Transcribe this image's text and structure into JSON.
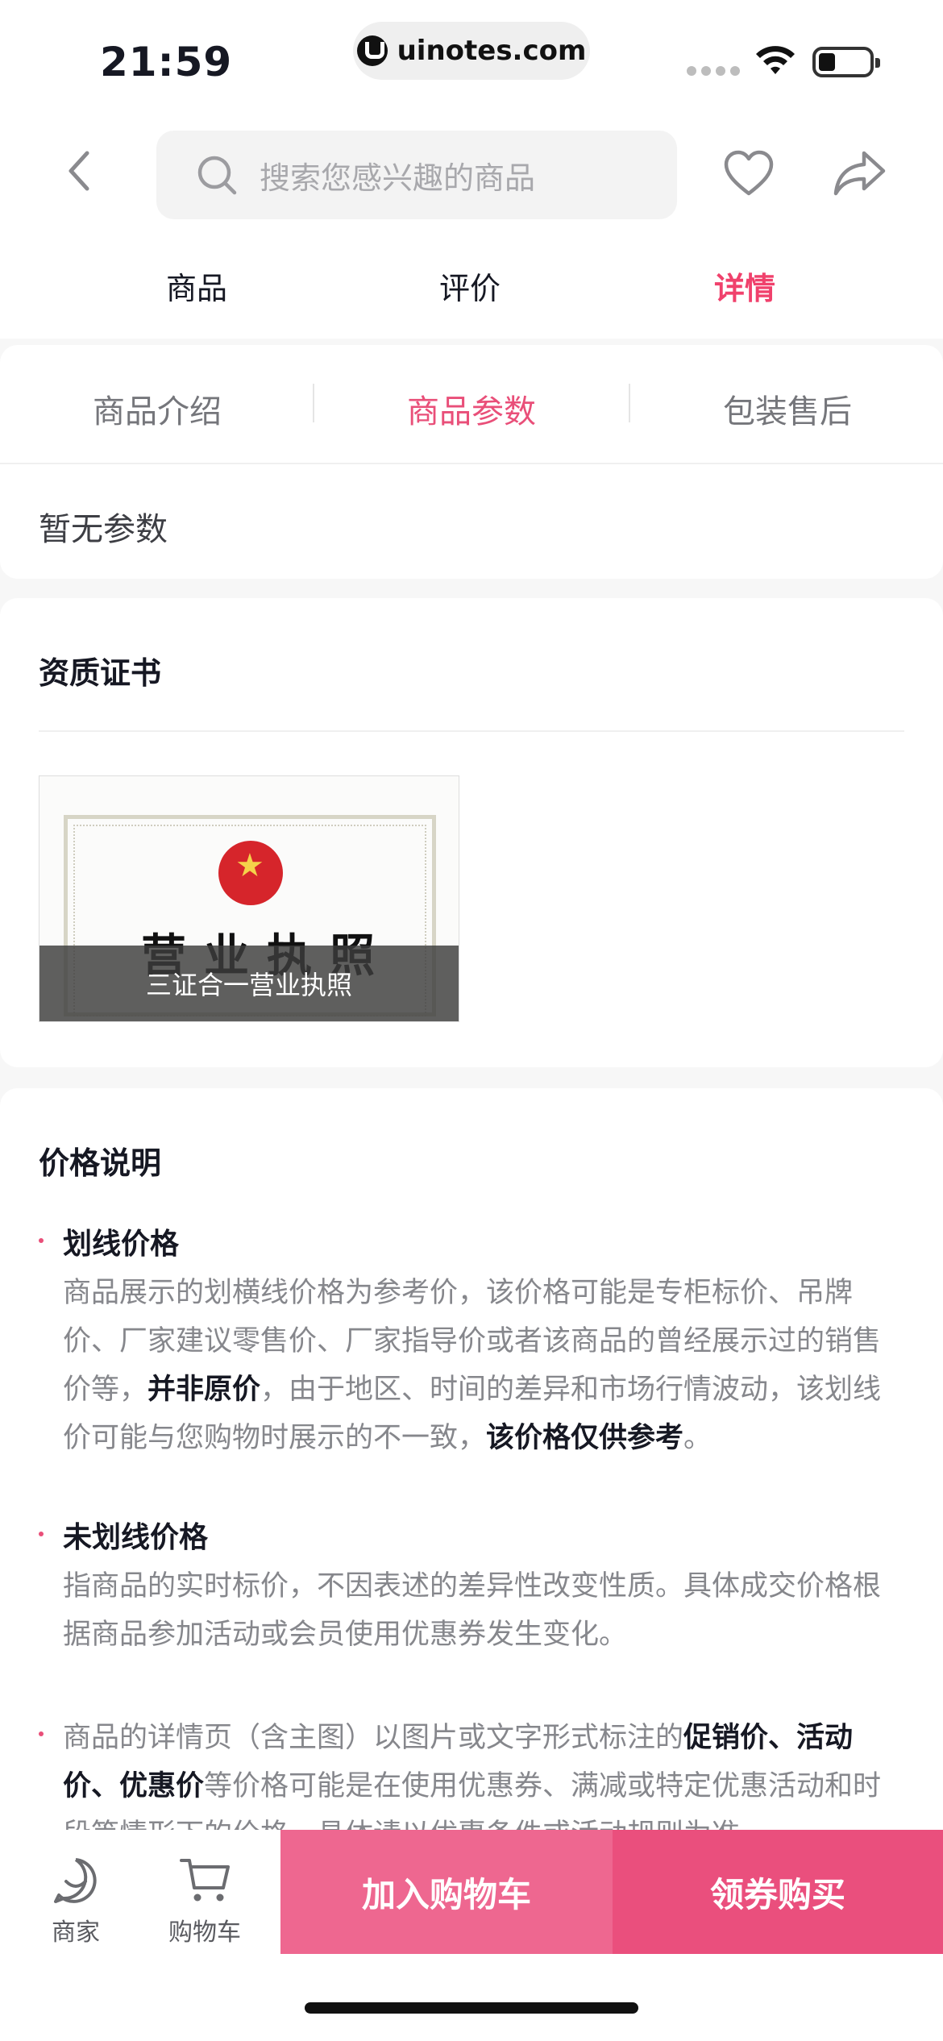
{
  "status_bar": {
    "time": "21:59",
    "url": "uinotes.com"
  },
  "search": {
    "placeholder": "搜索您感兴趣的商品"
  },
  "tabs": [
    {
      "label": "商品"
    },
    {
      "label": "评价"
    },
    {
      "label": "详情"
    }
  ],
  "subtabs": [
    {
      "label": "商品介绍"
    },
    {
      "label": "商品参数"
    },
    {
      "label": "包装售后"
    }
  ],
  "params_empty": "暂无参数",
  "certificates": {
    "title": "资质证书",
    "item_caption": "三证合一营业执照",
    "image_text": "营业执照"
  },
  "price_info": {
    "title": "价格说明",
    "items": [
      {
        "title": "划线价格",
        "body_parts": [
          "商品展示的划横线价格为参考价，该价格可能是专柜标价、吊牌价、厂家建议零售价、厂家指导价或者该商品的曾经展示过的销售价等，",
          "并非原价",
          "，由于地区、时间的差异和市场行情波动，该划线价可能与您购物时展示的不一致，",
          "该价格仅供参考",
          "。"
        ]
      },
      {
        "title": "未划线价格",
        "body": "指商品的实时标价，不因表述的差异性改变性质。具体成交价格根据商品参加活动或会员使用优惠券发生变化。"
      },
      {
        "body_parts": [
          "商品的详情页（含主图）以图片或文字形式标注的",
          "促销价、活动价、优惠价",
          "等价格可能是在使用优惠券、满减或特定优惠活动和时段等情形下的价格，具体请以优惠条件或活动规则为准。"
        ]
      }
    ]
  },
  "bottom_bar": {
    "shop_label": "商家",
    "cart_label": "购物车",
    "add_to_cart": "加入购物车",
    "coupon_buy": "领券购买"
  },
  "colors": {
    "accent": "#e94f79",
    "cart_button": "#ee6790",
    "buy_button": "#ea4f7d"
  }
}
